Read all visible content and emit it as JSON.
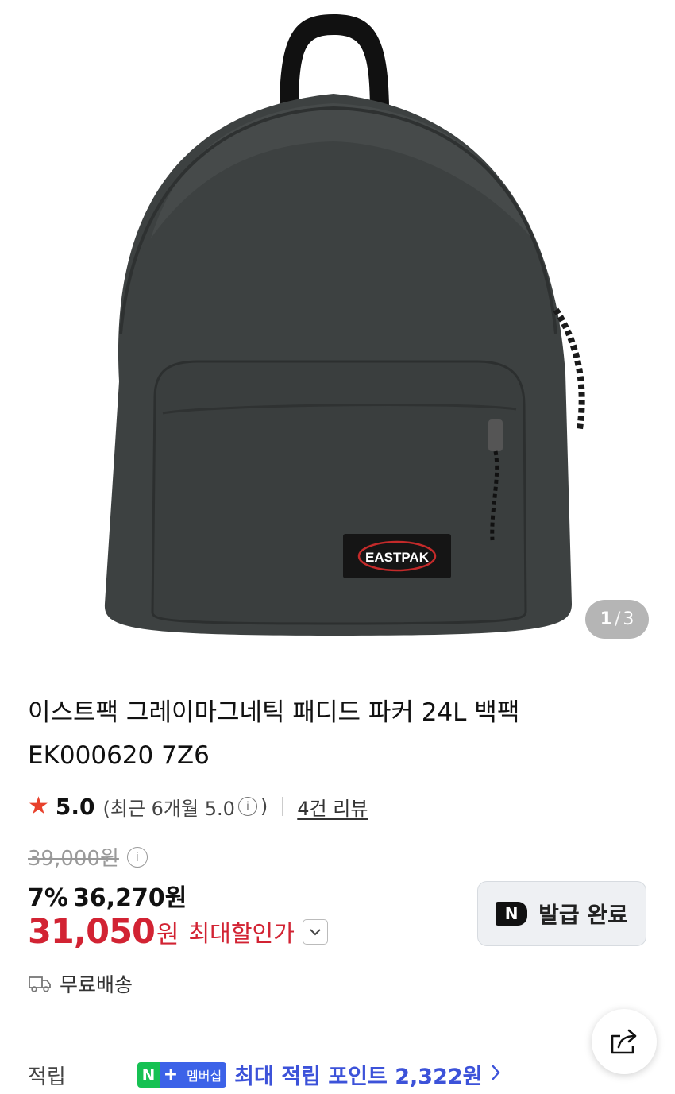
{
  "gallery": {
    "current": "1",
    "separator": "/",
    "total": "3",
    "logo_text": "EASTPAK"
  },
  "product": {
    "title_line1": "이스트팩 그레이마그네틱 패디드 파커 24L 백팩",
    "title_line2": "EK000620 7Z6"
  },
  "rating": {
    "score": "5.0",
    "recent_prefix": "(최근 6개월 5.0",
    "info_glyph": "i",
    "recent_suffix": ")",
    "review_link": "4건 리뷰"
  },
  "price": {
    "original": "39,000원",
    "discount_pct": "7%",
    "sale_price": "36,270원",
    "max_price_num": "31,050",
    "max_price_unit": "원",
    "max_label": "최대할인가"
  },
  "coupon": {
    "badge": "N",
    "label": "발급 완료"
  },
  "shipping": {
    "label": "무료배송"
  },
  "points": {
    "label": "적립",
    "badge_n": "N",
    "badge_plus": "+",
    "badge_member": "멤버십",
    "text": "최대 적립 포인트 2,322원"
  },
  "colors": {
    "price_red": "#d22333",
    "star": "#e8412c",
    "points_blue": "#3c52d9",
    "npay_green": "#16c153"
  },
  "icons": [
    "star-icon",
    "info-icon",
    "chevron-down-icon",
    "truck-icon",
    "share-icon",
    "chevron-right-icon"
  ]
}
